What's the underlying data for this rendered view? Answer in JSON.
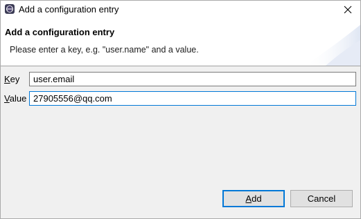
{
  "window": {
    "title": "Add a configuration entry",
    "close_symbol": "close-icon"
  },
  "banner": {
    "title": "Add a configuration entry",
    "message": "Please enter a key, e.g. \"user.name\" and a value."
  },
  "form": {
    "key": {
      "label_mnemonic": "K",
      "label_rest": "ey",
      "value": "user.email"
    },
    "value": {
      "label_mnemonic": "V",
      "label_rest": "alue",
      "value": "27905556@qq.com"
    }
  },
  "buttons": {
    "add": {
      "mnemonic": "A",
      "rest": "dd"
    },
    "cancel": {
      "label": "Cancel"
    }
  },
  "colors": {
    "accent": "#0078d7",
    "dialog_bg": "#f0f0f0",
    "button_bg": "#e1e1e1"
  },
  "icons": {
    "app": "eclipse-app-icon",
    "close": "close-icon"
  }
}
